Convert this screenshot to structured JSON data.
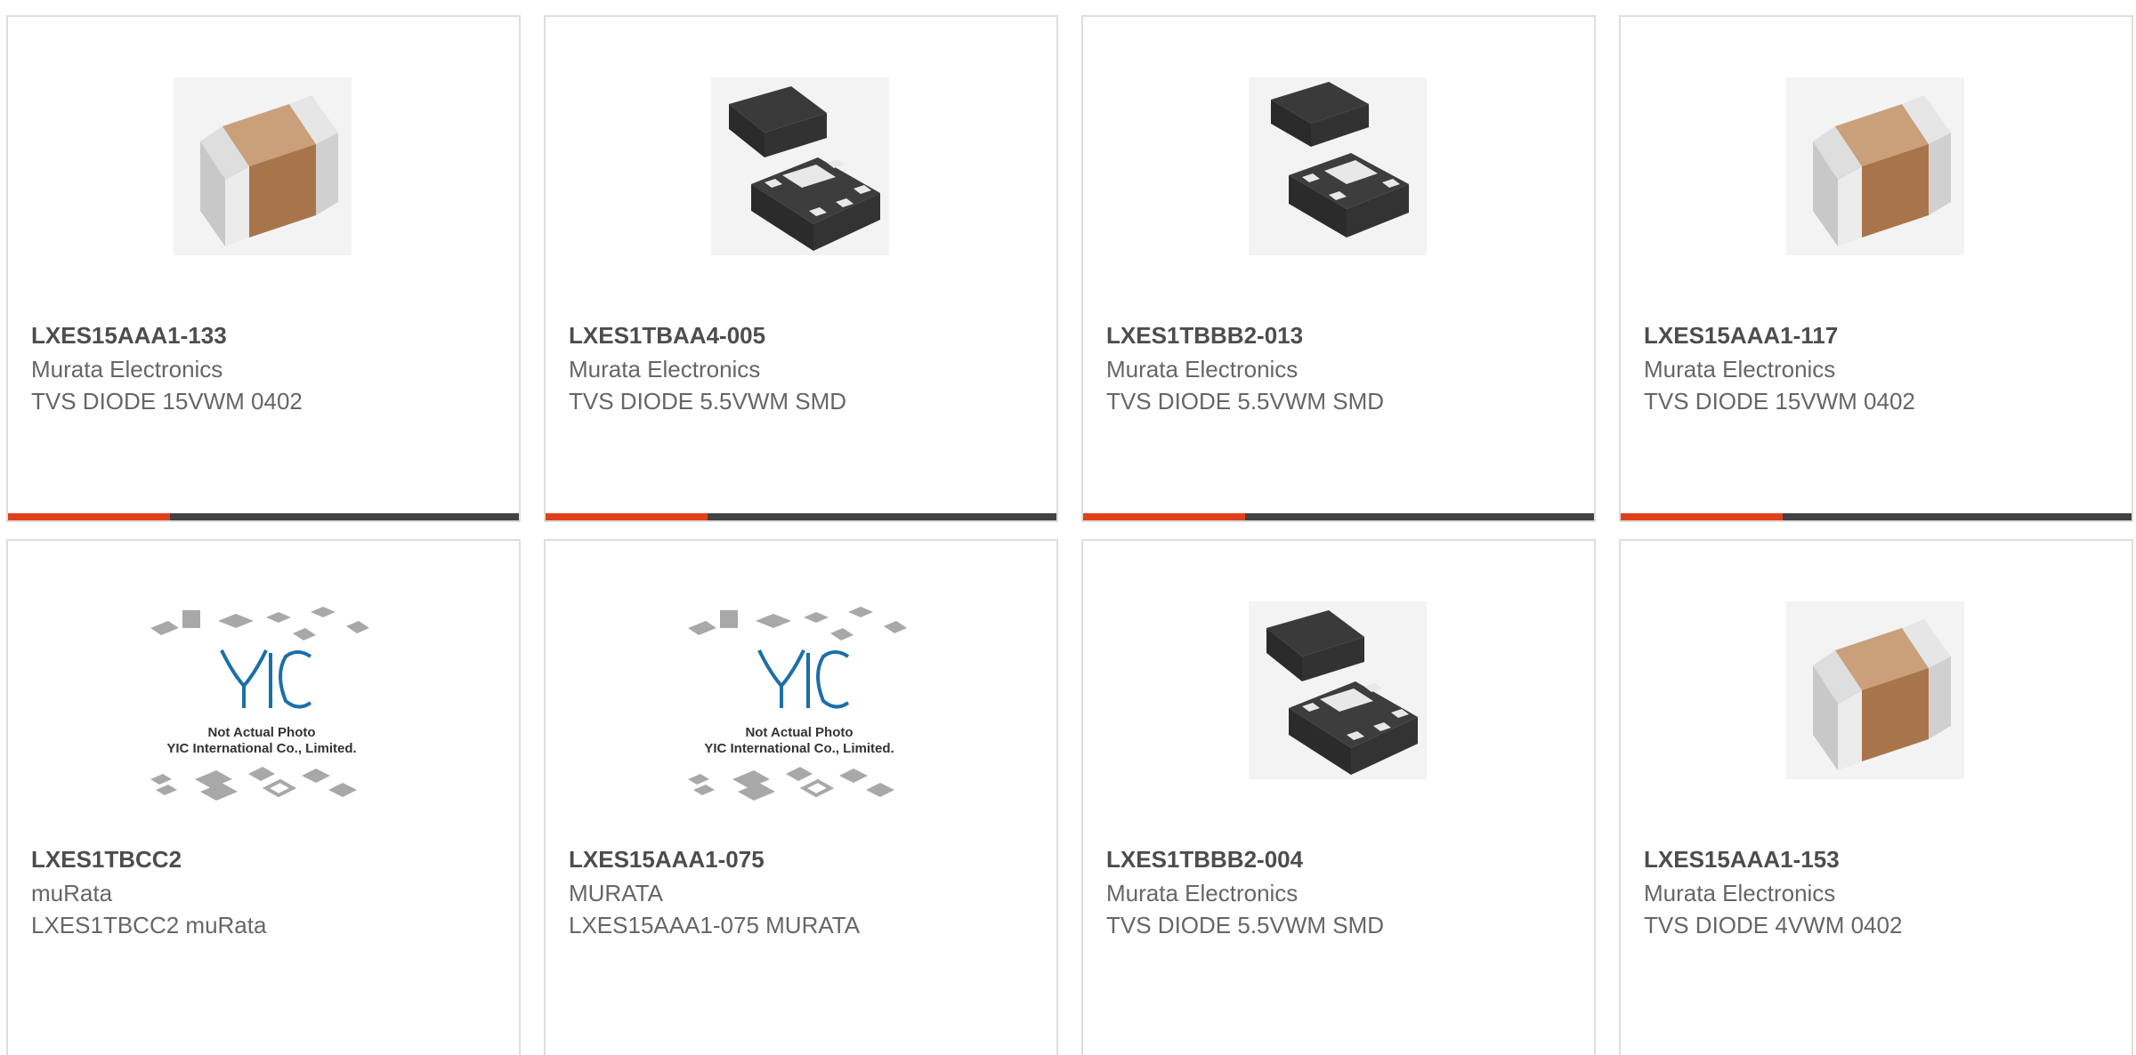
{
  "colors": {
    "accent": "#e2401c",
    "bar_dark": "#424242",
    "card_border": "#dedede",
    "text_bold": "#4d4d4d",
    "text": "#666666"
  },
  "cards": [
    {
      "part_number": "LXES15AAA1-133",
      "manufacturer": "Murata Electronics",
      "description": "TVS DIODE 15VWM 0402",
      "image": "chip-capacitor-0402-icon"
    },
    {
      "part_number": "LXES1TBAA4-005",
      "manufacturer": "Murata Electronics",
      "description": "TVS DIODE 5.5VWM SMD",
      "image": "dfn-package-icon"
    },
    {
      "part_number": "LXES1TBBB2-013",
      "manufacturer": "Murata Electronics",
      "description": "TVS DIODE 5.5VWM SMD",
      "image": "dfn-package-icon"
    },
    {
      "part_number": "LXES15AAA1-117",
      "manufacturer": "Murata Electronics",
      "description": "TVS DIODE 15VWM 0402",
      "image": "chip-capacitor-0402-icon"
    },
    {
      "part_number": "LXES1TBCC2",
      "manufacturer": "muRata",
      "description": "LXES1TBCC2 muRata",
      "image": "yic-placeholder-icon",
      "placeholder_line1": "Not Actual Photo",
      "placeholder_line2": "YIC International Co., Limited."
    },
    {
      "part_number": "LXES15AAA1-075",
      "manufacturer": "MURATA",
      "description": "LXES15AAA1-075 MURATA",
      "image": "yic-placeholder-icon",
      "placeholder_line1": "Not Actual Photo",
      "placeholder_line2": "YIC International Co., Limited."
    },
    {
      "part_number": "LXES1TBBB2-004",
      "manufacturer": "Murata Electronics",
      "description": "TVS DIODE 5.5VWM SMD",
      "image": "dfn-package-icon"
    },
    {
      "part_number": "LXES15AAA1-153",
      "manufacturer": "Murata Electronics",
      "description": "TVS DIODE 4VWM 0402",
      "image": "chip-capacitor-0402-icon"
    }
  ]
}
